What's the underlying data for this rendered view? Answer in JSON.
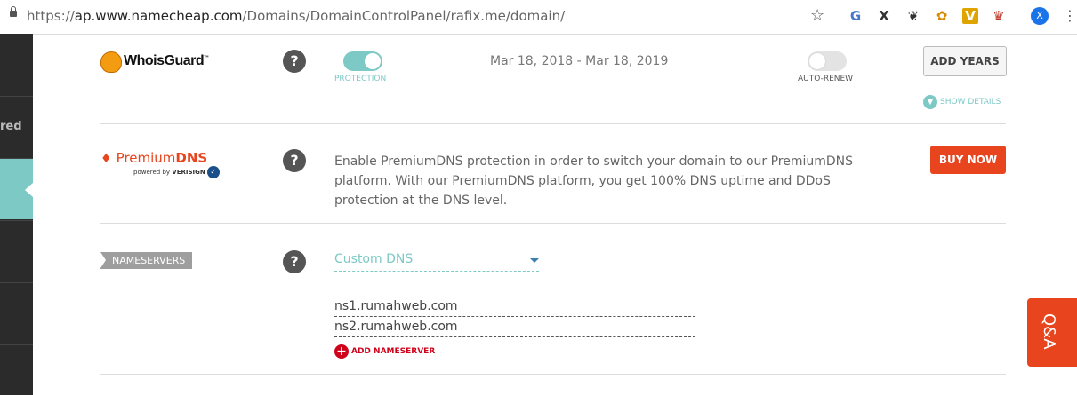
{
  "browser": {
    "url_prefix": "https://",
    "url_host": "ap.www.namecheap.com",
    "url_path": "/Domains/DomainControlPanel/rafix.me/domain/",
    "star_icon": "☆",
    "ext_icons": [
      "G",
      "X",
      "❦",
      "✿",
      "V",
      "♛"
    ],
    "avatar_letter": "X",
    "menu_icon": "⋮"
  },
  "sidebar": {
    "partial_label": "red"
  },
  "whoisguard": {
    "logo_text": "WhoisGuard",
    "logo_tm": "™",
    "help": "?",
    "protection_label": "PROTECTION",
    "protection_on": true,
    "dates": "Mar 18, 2018 - Mar 18, 2019",
    "autorenew_label": "AUTO-RENEW",
    "autorenew_on": false,
    "add_years_label": "ADD YEARS",
    "show_details_label": "SHOW DETAILS"
  },
  "premiumdns": {
    "logo_part1": "Premium",
    "logo_part2": "DNS",
    "powered_by": "powered by ",
    "verisign": "VERISIGN",
    "help": "?",
    "description": "Enable PremiumDNS protection in order to switch your domain to our PremiumDNS platform. With our PremiumDNS platform, you get 100% DNS uptime and DDoS protection at the DNS level.",
    "buy_label": "BUY NOW"
  },
  "nameservers": {
    "tag": "NAMESERVERS",
    "help": "?",
    "selected": "Custom DNS",
    "servers": [
      "ns1.rumahweb.com",
      "ns2.rumahweb.com"
    ],
    "add_label": "ADD NAMESERVER"
  },
  "qa": {
    "label": "Q&A"
  },
  "colors": {
    "teal": "#7cc9c6",
    "orange": "#e8441e",
    "red": "#d0021b",
    "sidebar": "#2b2b2b"
  }
}
